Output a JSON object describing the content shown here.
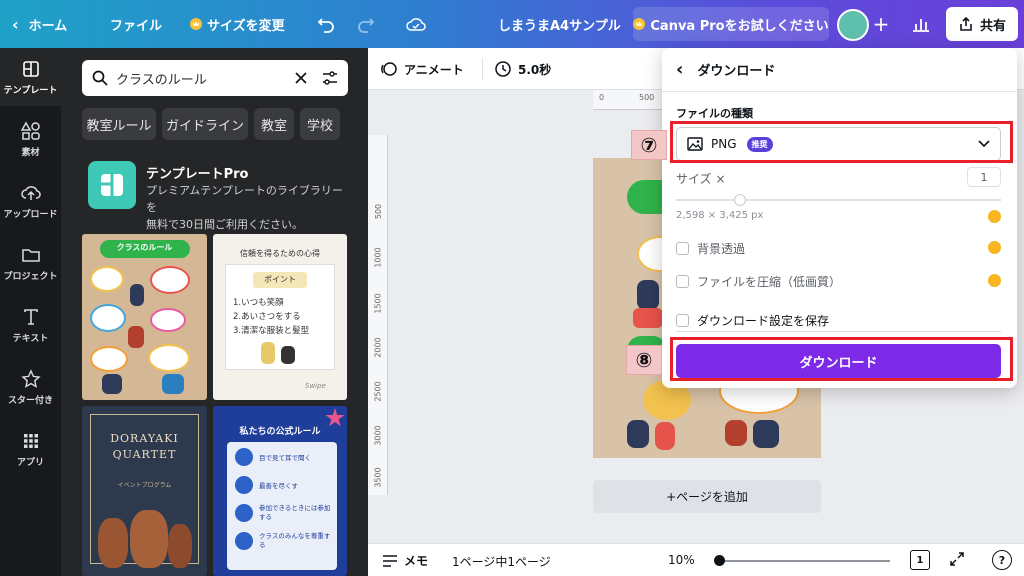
{
  "topbar": {
    "home": "ホーム",
    "file": "ファイル",
    "resize": "サイズを変更",
    "doc_title": "しまうまA4サンプル",
    "pro_trial": "Canva Proをお試しください",
    "share": "共有"
  },
  "rail": [
    {
      "label": "テンプレート",
      "icon": "template-icon"
    },
    {
      "label": "素材",
      "icon": "elements-icon"
    },
    {
      "label": "アップロード",
      "icon": "upload-icon"
    },
    {
      "label": "プロジェクト",
      "icon": "folder-icon"
    },
    {
      "label": "テキスト",
      "icon": "text-icon"
    },
    {
      "label": "スター付き",
      "icon": "star-icon"
    },
    {
      "label": "アプリ",
      "icon": "apps-icon"
    }
  ],
  "panel": {
    "search_value": "クラスのルール",
    "chips": [
      "教室ルール",
      "ガイドライン",
      "教室",
      "学校"
    ],
    "promo_title": "テンプレートPro",
    "promo_desc_1": "プレミアムテンプレートのライブラリーを",
    "promo_desc_2": "無料で30日間ご利用ください。",
    "thumbs": {
      "t1_title": "クラスのルール",
      "t2_title": "信頼を得るための心得",
      "t2_point": "ポイント",
      "t2_line1": "1.いつも笑顔",
      "t2_line2": "2.あいさつをする",
      "t2_line3": "3.清潔な服装と髪型",
      "t2_sub": "Swipe",
      "t3_line1": "DORAYAKI",
      "t3_line2": "QUARTET",
      "t3_sub": "イベントプログラム",
      "t4_title": "私たちの公式ルール",
      "t4_r1": "目で見て耳で聞く",
      "t4_r2": "最善を尽くす",
      "t4_r3": "参加できるときには参加する",
      "t4_r4": "クラスのみんなを尊重する"
    }
  },
  "canvas": {
    "animate": "アニメート",
    "duration": "5.0秒",
    "ruler_top": [
      "0",
      "500"
    ],
    "ruler_left": [
      "500",
      "1000",
      "1500",
      "2000",
      "2500",
      "3000",
      "3500"
    ],
    "add_page": "+ページを追加"
  },
  "bottom": {
    "memo": "メモ",
    "page_count": "1ページ中1ページ",
    "zoom": "10%",
    "page_icon_num": "1",
    "help": "?"
  },
  "download": {
    "header": "ダウンロード",
    "file_type_label": "ファイルの種類",
    "file_type": "PNG",
    "recommended": "推奨",
    "size_label": "サイズ ×",
    "size_value": "1",
    "dimensions": "2,598 × 3,425 px",
    "transparent_bg": "背景透過",
    "compress": "ファイルを圧縮（低画質）",
    "save_settings": "ダウンロード設定を保存",
    "button": "ダウンロード"
  },
  "annotations": {
    "step7": "⑦",
    "step8": "⑧"
  },
  "colors": {
    "accent": "#7d2ae8",
    "pro_gold": "#f7b51f",
    "highlight_red": "#e8202a"
  }
}
